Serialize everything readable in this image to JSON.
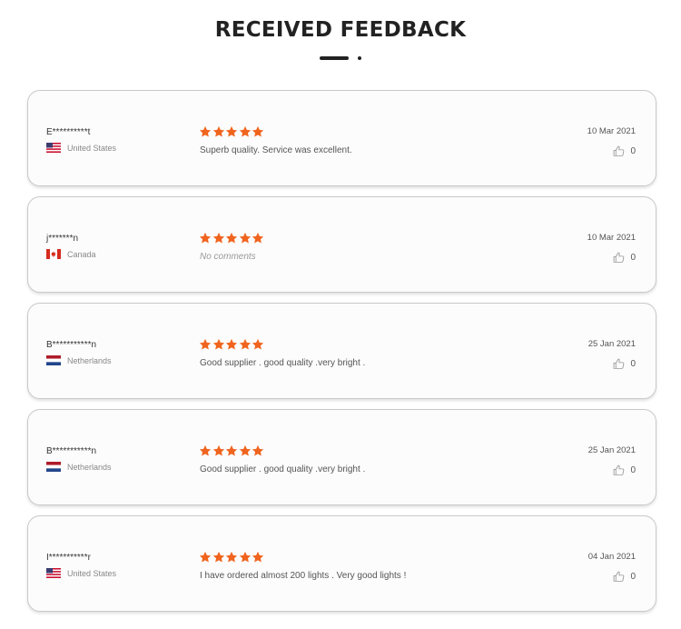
{
  "header": {
    "title": "RECEIVED FEEDBACK"
  },
  "colors": {
    "star": "#f0641e",
    "title": "#222222",
    "card_border": "#c9c9c9"
  },
  "reviews": [
    {
      "name": "E**********t",
      "country": "United States",
      "flag": "us-flag-icon",
      "rating": 5,
      "comment": "Superb quality. Service was excellent.",
      "date": "10 Mar 2021",
      "likes": "0"
    },
    {
      "name": "j*******n",
      "country": "Canada",
      "flag": "ca-flag-icon",
      "rating": 5,
      "comment": "No comments",
      "date": "10 Mar 2021",
      "likes": "0"
    },
    {
      "name": "B***********n",
      "country": "Netherlands",
      "flag": "nl-flag-icon",
      "rating": 5,
      "comment": "Good supplier . good quality .very bright .",
      "date": "25 Jan 2021",
      "likes": "0"
    },
    {
      "name": "B***********n",
      "country": "Netherlands",
      "flag": "nl-flag-icon",
      "rating": 5,
      "comment": "Good supplier . good quality .very bright .",
      "date": "25 Jan 2021",
      "likes": "0"
    },
    {
      "name": "I***********r",
      "country": "United States",
      "flag": "us-flag-icon",
      "rating": 5,
      "comment": "I have ordered almost 200 lights . Very good lights !",
      "date": "04 Jan 2021",
      "likes": "0"
    }
  ]
}
